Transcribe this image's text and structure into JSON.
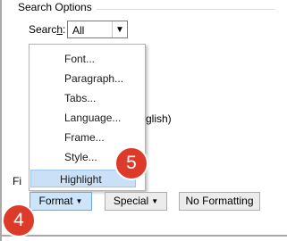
{
  "group": {
    "title": "Search Options"
  },
  "search": {
    "label_prefix": "Searc",
    "label_accel": "h",
    "label_suffix": ":",
    "value": "All"
  },
  "background": {
    "partial_text": "glish)",
    "partial_label": "Fi"
  },
  "menu": {
    "items": [
      {
        "label": "Font..."
      },
      {
        "label": "Paragraph..."
      },
      {
        "label": "Tabs..."
      },
      {
        "label": "Language..."
      },
      {
        "label": "Frame..."
      },
      {
        "label": "Style..."
      },
      {
        "label": "Highlight"
      }
    ],
    "selected_index": 6
  },
  "buttons": {
    "format": "Format",
    "special": "Special",
    "no_formatting": "No Formatting"
  },
  "callouts": {
    "format_step": "4",
    "highlight_step": "5"
  },
  "colors": {
    "badge": "#dd3a2a",
    "menu_highlight": "#c9e0f7",
    "button_active": "#cde5fb"
  }
}
